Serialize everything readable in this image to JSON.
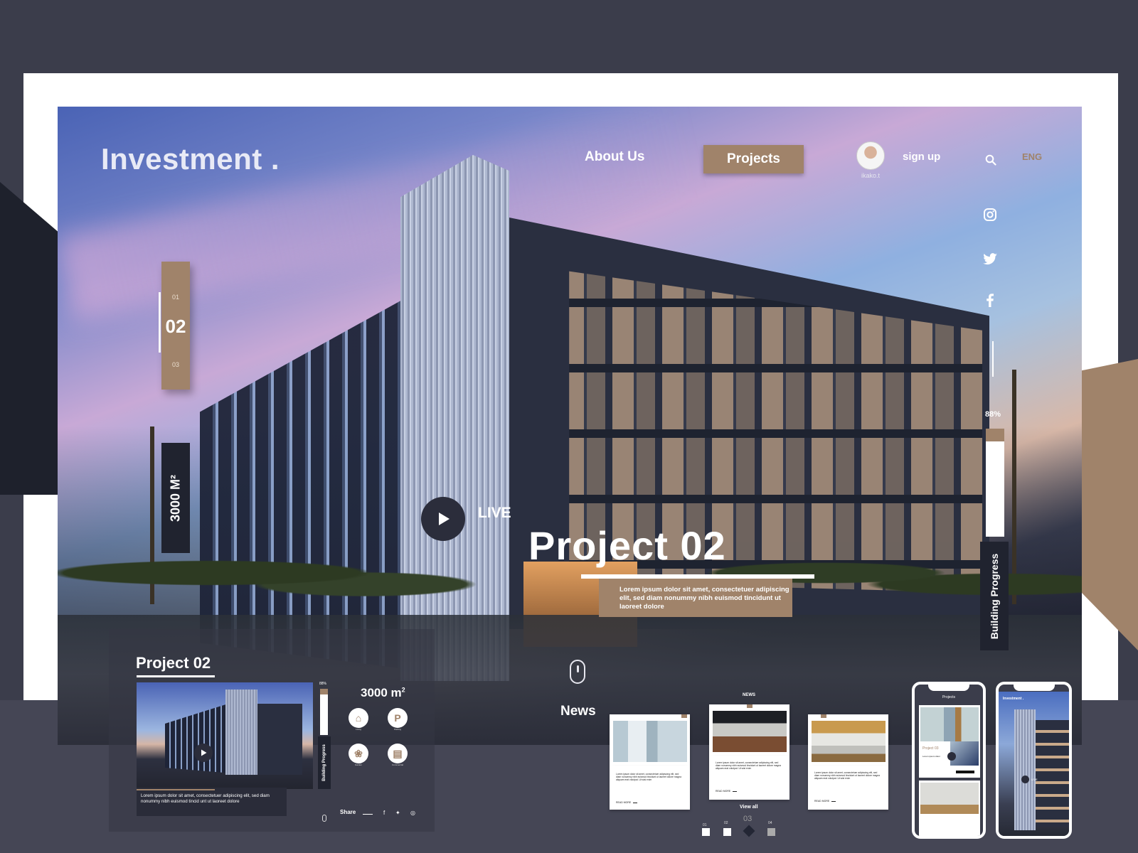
{
  "brand": {
    "logo": "Investment ."
  },
  "nav": {
    "about": "About Us",
    "projects": "Projects",
    "user_name": "ikako.t",
    "signup": "sign up",
    "language": "ENG"
  },
  "slider": {
    "items": [
      "01",
      "02",
      "03"
    ],
    "active": "02",
    "area_tag": "3000 M²"
  },
  "social": {
    "icons": [
      "instagram-icon",
      "twitter-icon",
      "facebook-icon"
    ]
  },
  "progress": {
    "percent_label": "88%",
    "value": 0.88,
    "label": "Building Progress"
  },
  "hero": {
    "live_label": "LIVE",
    "title": "Project  02",
    "description": "Lorem ipsum dolor sit amet, consectetuer adipiscing elit, sed diam nonummy nibh euismod tincidunt ut laoreet dolore"
  },
  "news_section": {
    "heading": "News",
    "sub_heading": "NEWS",
    "view_all": "View all",
    "cards": [
      {
        "text": "Lorem ipsum dolor sit amet, consectetuer adipiscing elit, sed diam nonummy nibh euismod tincidunt ut laoreet dolore magna aliquam erat volutpat. Ut wisi enim",
        "read_more": "READ MORE"
      },
      {
        "text": "Lorem ipsum dolor sit amet, consectetuer adipiscing elit, sed diam nonummy nibh euismod tincidunt ut laoreet dolore magna aliquam erat volutpat. Ut wisi enim",
        "read_more": "READ MORE"
      },
      {
        "text": "Lorem ipsum dolor sit amet, consectetuer adipiscing elit, sed diam nonummy nibh euismod tincidunt ut laoreet dolore magna aliquam erat volutpat. Ut wisi enim",
        "read_more": "READ MORE"
      }
    ],
    "pagination": [
      "01",
      "02",
      "03",
      "04"
    ],
    "pagination_active": "03"
  },
  "preview": {
    "title": "Project 02",
    "description": "Lorem ipsum dolor sit amet, consectetuer adipiscing elit, sed diam nonummy nibh euismod tincid unt ut laoreet dolore",
    "percent_label": "88%",
    "progress_label": "Building Progress",
    "area": "3000 m",
    "area_sup": "2",
    "amenities": [
      {
        "icon": "home-icon",
        "glyph": "⌂",
        "label": "Living"
      },
      {
        "icon": "parking-icon",
        "glyph": "P",
        "label": "Parking"
      },
      {
        "icon": "tree-icon",
        "glyph": "❀",
        "label": "Garden"
      },
      {
        "icon": "building-icon",
        "glyph": "▤",
        "label": "Commercial"
      }
    ],
    "share_label": "Share"
  },
  "phones": {
    "left": {
      "title": "Projects",
      "card_title": "Project 03",
      "card_sub": "Lorem ipsum dolor"
    },
    "right": {
      "brand": "Investment .",
      "live_label": "LIVE"
    }
  },
  "colors": {
    "accent": "#a0836a",
    "dark": "#20232f",
    "background": "#3b3d4b"
  }
}
